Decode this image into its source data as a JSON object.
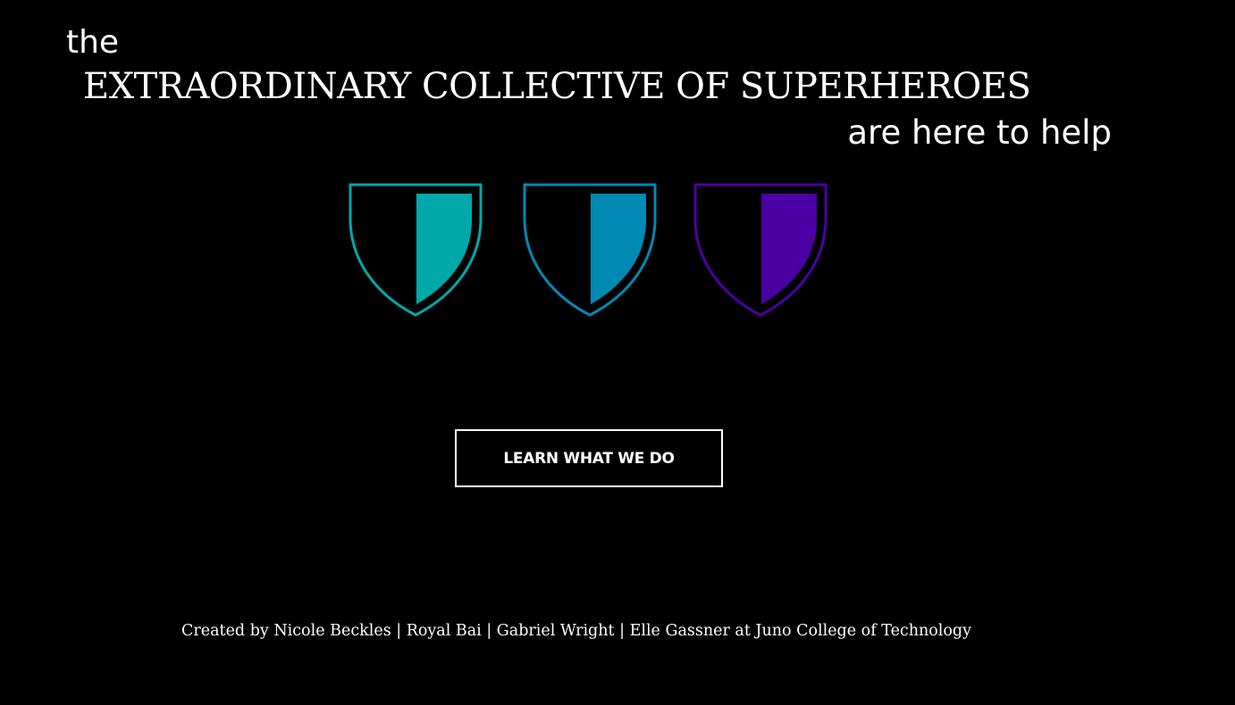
{
  "hero": {
    "eyebrow": "the",
    "headline": "EXTRAORDINARY COLLECTIVE OF SUPERHEROES",
    "tagline": "are here to help"
  },
  "shields": [
    {
      "name": "teal",
      "color": "#00a8a8",
      "icon": "shield-icon"
    },
    {
      "name": "blue",
      "color": "#0089b3",
      "icon": "shield-icon"
    },
    {
      "name": "purple",
      "color": "#4a00a2",
      "icon": "shield-icon"
    }
  ],
  "cta": {
    "label": "LEARN WHAT WE DO"
  },
  "footer": {
    "credits": "Created by Nicole Beckles | Royal Bai | Gabriel Wright | Elle Gassner at Juno College of Technology"
  }
}
